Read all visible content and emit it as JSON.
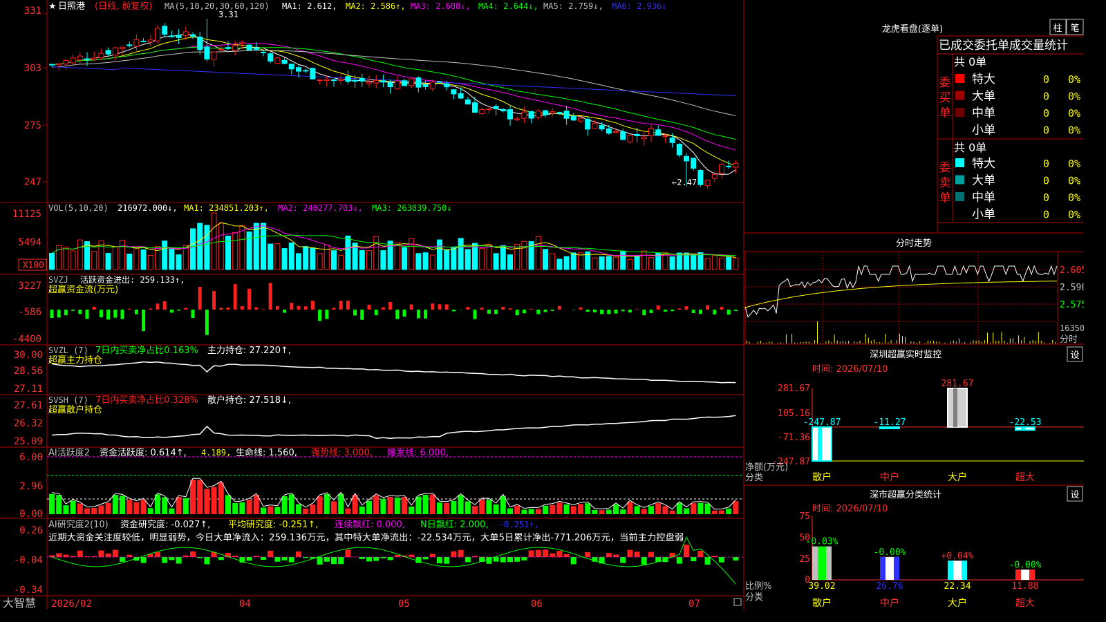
{
  "stock": {
    "star": "★",
    "name": "日照港",
    "mode": "(日线, 前复权)",
    "ma_text": "MA(5,10,20,30,60,120)",
    "ma": [
      {
        "label": "MA1: 2.612,",
        "color": "#ffffff"
      },
      {
        "label": "MA2: 2.586↑,",
        "color": "#ffff00"
      },
      {
        "label": "MA3: 2.608↓,",
        "color": "#ff00ff"
      },
      {
        "label": "MA4: 2.644↓,",
        "color": "#00ff00"
      },
      {
        "label": "MA5: 2.759↓,",
        "color": "#c0c0c0"
      },
      {
        "label": "MA6: 2.936↓",
        "color": "#3030ff"
      }
    ],
    "high_mark": "3.31",
    "low_mark": "←2.47",
    "price_axis": [
      "331",
      "303",
      "275",
      "247"
    ]
  },
  "colors": {
    "up": "#ff2020",
    "down": "#00ffff",
    "grid": "#b00000",
    "green": "#00ff00",
    "white": "#ffffff",
    "yellow": "#ffff00",
    "magenta": "#ff00ff"
  },
  "chart_data": {
    "type": "candlestick",
    "title": "日照港 (日线, 前复权)",
    "indicators": {
      "MA1": 2.612,
      "MA2": 2.586,
      "MA3": 2.608,
      "MA4": 2.644,
      "MA5": 2.759,
      "MA6": 2.936,
      "VOL": 216972.0,
      "VOL_MA1": 234851.203,
      "VOL_MA2": 240277.703,
      "VOL_MA3": 263039.75,
      "SVZJ_active_flow": 259.133,
      "SVZL_7d_net_ratio_pct": 0.163,
      "SVZL_main_hold": 27.22,
      "SVSH_7d_net_ratio_pct": 0.328,
      "SVSH_retail_hold": 27.518,
      "AI_activity": 0.614,
      "AI_activity_2": 4.189,
      "life_line": 1.56,
      "strong_line": 3.0,
      "burst_line": 6.0,
      "AI_research": -0.027,
      "AI_avg_research": -0.251,
      "consecutive_red": 0.0,
      "N_day_red": 2.0,
      "N_day_red_2": -0.251
    },
    "price_range": [
      2.4,
      3.37
    ],
    "high": 3.31,
    "low": 2.47,
    "x_ticks": [
      "2026/02",
      "04",
      "05",
      "06",
      "07"
    ],
    "sz_realtime": {
      "date": "2026/07/10",
      "categories": [
        "散户",
        "中户",
        "大户",
        "超大"
      ],
      "values": [
        -247.87,
        -11.27,
        281.67,
        -22.53
      ],
      "ylim": [
        -247.87,
        281.67
      ],
      "unit": "净额(万元)"
    },
    "sz_category": {
      "date": "2026/07/10",
      "categories": [
        "散户",
        "中户",
        "大户",
        "超大"
      ],
      "values": [
        39.02,
        26.76,
        22.34,
        11.88
      ],
      "changes": [
        "-0.03%",
        "-0.00%",
        "+0.04%",
        "-0.00%"
      ],
      "ylim": [
        0,
        75
      ],
      "unit": "比例%"
    }
  },
  "vol": {
    "header": "VOL(5,10,20)",
    "value": "216972.000↓,",
    "ma1": "MA1: 234851.203↑,",
    "ma2": "MA2: 240277.703↓,",
    "ma3": "MA3: 263039.750↓",
    "axis": [
      "11125",
      "5494"
    ],
    "unit": "X100"
  },
  "svzj": {
    "header": "SVZJ",
    "label": "活跃资金进出: 259.133↑,",
    "sub": "超赢资金流(万元)",
    "axis": [
      "3227",
      "-586",
      "-4400"
    ]
  },
  "svzl": {
    "header": "SVZL (7)",
    "label1": "7日内买卖净占比0.163%",
    "label2": "主力持仓: 27.220↑,",
    "sub": "超赢主力持仓",
    "axis": [
      "30.00",
      "28.56",
      "27.11"
    ]
  },
  "svsh": {
    "header": "SVSH (7)",
    "label1": "7日内买卖净占比0.328%",
    "label2": "散户持仓: 27.518↓,",
    "sub": "超赢散户持仓",
    "axis": [
      "27.61",
      "26.32",
      "25.09"
    ]
  },
  "ai1": {
    "header": "AI活跃度2",
    "label1": "资金活跃度: 0.614↑,",
    "label2": "4.189,",
    "label3": "生命线: 1.560,",
    "label4": "强势线: 3.000,",
    "label5": "爆发线: 6.000,",
    "axis": [
      "6.00",
      "2.96",
      "0.00"
    ]
  },
  "ai2": {
    "header": "AI研究度2(10)",
    "label1": "资金研究度: -0.027↑,",
    "label2": "平均研究度: -0.251↑,",
    "label3": "连续飘红: 0.000,",
    "label4": "N日飘红: 2.000,",
    "label5": "-0.251↑,",
    "comment": "近期大资金关注度较低，明显弱势，今日大单净流入：259.136万元，其中特大单净流出：-22.534万元，大单5日累计净出-771.206万元，当前主力控盘弱",
    "axis": [
      "0.26",
      "-0.04",
      "-0.34"
    ]
  },
  "footer": {
    "brand": "大智慧",
    "dates": [
      "2026/02",
      "04",
      "05",
      "06",
      "07"
    ]
  },
  "right": {
    "lhkp_title": "龙虎看盘(逐单)",
    "btn_zhu": "柱",
    "btn_bi": "笔",
    "tabs": "已成交委托单成交量统计",
    "buy_label": "委买单",
    "sell_label": "委卖单",
    "buy_total": "共 0单",
    "sell_total": "共 0单",
    "buy_rows": [
      {
        "name": "特大",
        "count": "0",
        "pct": "0%",
        "color": "#ff0000"
      },
      {
        "name": "大单",
        "count": "0",
        "pct": "0%",
        "color": "#a00000"
      },
      {
        "name": "中单",
        "count": "0",
        "pct": "0%",
        "color": "#700000"
      },
      {
        "name": "小单",
        "count": "0",
        "pct": "0%",
        "color": ""
      }
    ],
    "sell_rows": [
      {
        "name": "特大",
        "count": "0",
        "pct": "0%",
        "color": "#00ffff"
      },
      {
        "name": "大单",
        "count": "0",
        "pct": "0%",
        "color": "#00a0a0"
      },
      {
        "name": "中单",
        "count": "0",
        "pct": "0%",
        "color": "#007070"
      },
      {
        "name": "小单",
        "count": "0",
        "pct": "0%",
        "color": ""
      }
    ],
    "fenshi_title": "分时走势",
    "fenshi_axis": [
      "2.605",
      "2.590",
      "2.575"
    ],
    "fenshi_vol": "16350",
    "fenshi_vol_unit": "分时",
    "sz_title": "深圳超赢实时监控",
    "sz_date": "时间: 2026/07/10",
    "sz_set": "设",
    "sz_axis": [
      "281.67",
      "105.16",
      "-71.36",
      "-247.87"
    ],
    "sz_unit": "净额(万元)",
    "sz_unit2": "分类",
    "sz_labels": [
      "-247.87",
      "-11.27",
      "281.67",
      "-22.53"
    ],
    "cat_title": "深市超赢分类统计",
    "cat_date": "时间: 2026/07/10",
    "cat_set": "设",
    "cat_axis": [
      "75",
      "50",
      "25",
      "0"
    ],
    "cat_unit": "比例%",
    "cat_unit2": "分类",
    "cat_vals": [
      "39.02",
      "26.76",
      "22.34",
      "11.88"
    ],
    "cat_changes": [
      "-0.03%",
      "-0.00%",
      "+0.04%",
      "-0.00%"
    ],
    "categories": [
      "散户",
      "中户",
      "大户",
      "超大"
    ]
  }
}
